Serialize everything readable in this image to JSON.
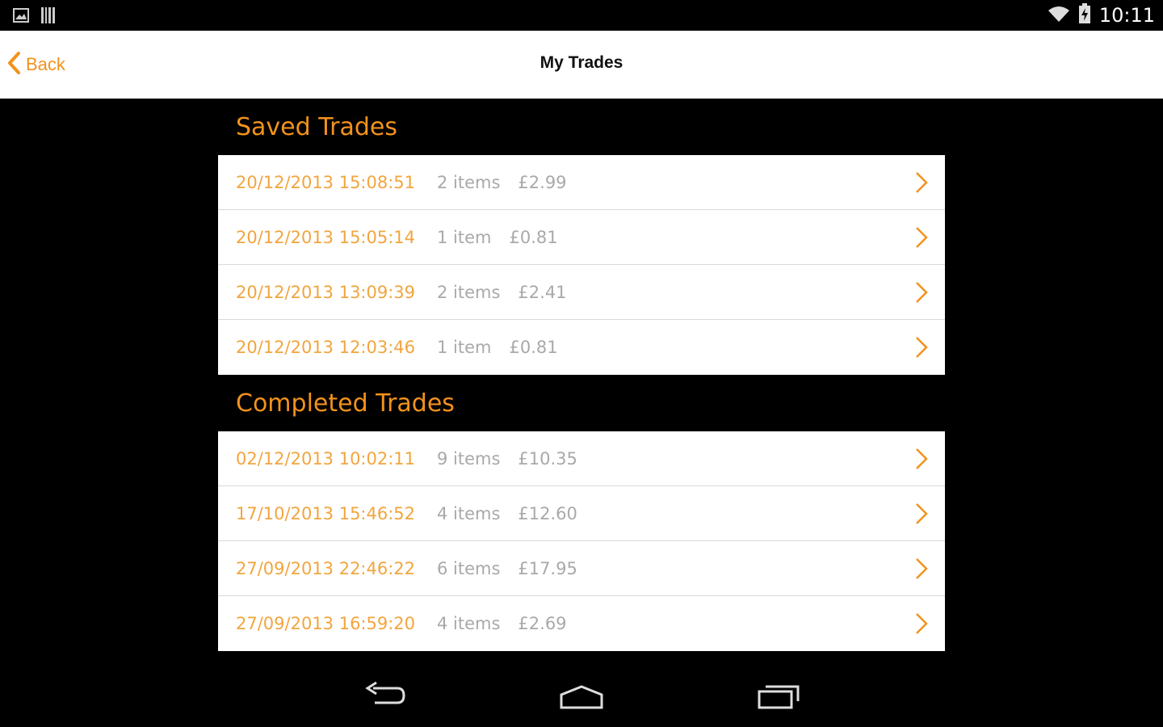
{
  "status_bar": {
    "time": "10:11",
    "left_icons": [
      "gallery-icon",
      "barcode-icon"
    ],
    "right_icons": [
      "wifi-icon",
      "battery-charging-icon"
    ]
  },
  "header": {
    "back_label": "Back",
    "title": "My Trades"
  },
  "saved": {
    "title": "Saved Trades",
    "rows": [
      {
        "date": "20/12/2013 15:08:51",
        "items": "2 items",
        "price": "£2.99"
      },
      {
        "date": "20/12/2013 15:05:14",
        "items": "1 item",
        "price": "£0.81"
      },
      {
        "date": "20/12/2013 13:09:39",
        "items": "2 items",
        "price": "£2.41"
      },
      {
        "date": "20/12/2013 12:03:46",
        "items": "1 item",
        "price": "£0.81"
      }
    ]
  },
  "completed": {
    "title": "Completed Trades",
    "rows": [
      {
        "date": "02/12/2013 10:02:11",
        "items": "9 items",
        "price": "£10.35"
      },
      {
        "date": "17/10/2013 15:46:52",
        "items": "4 items",
        "price": "£12.60"
      },
      {
        "date": "27/09/2013 22:46:22",
        "items": "6 items",
        "price": "£17.95"
      },
      {
        "date": "27/09/2013 16:59:20",
        "items": "4 items",
        "price": "£2.69"
      }
    ]
  },
  "nav": [
    "nav-back-icon",
    "nav-home-icon",
    "nav-recents-icon"
  ],
  "colors": {
    "accent": "#f2921c",
    "muted": "#a9a9a9"
  }
}
